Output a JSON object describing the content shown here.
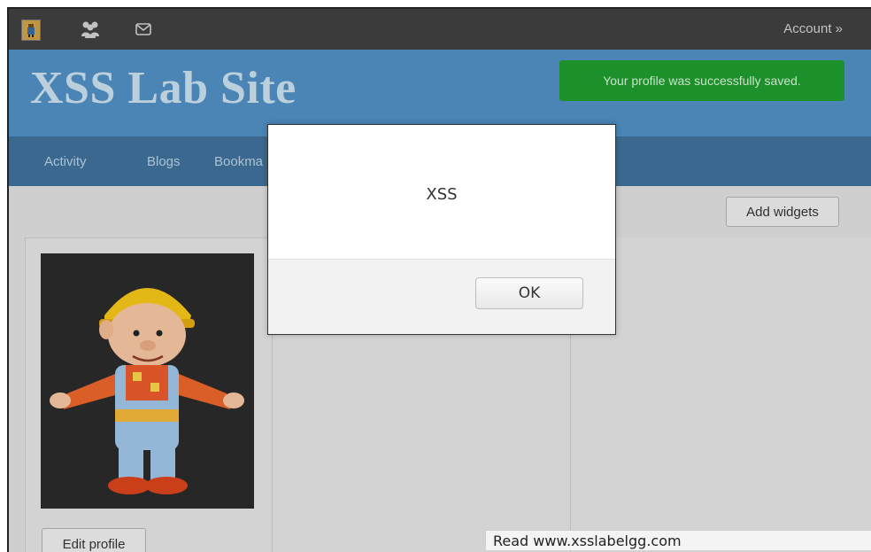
{
  "topbar": {
    "icons": [
      "elgg-logo-icon",
      "friends-icon",
      "mail-icon"
    ],
    "account_label": "Account »"
  },
  "header": {
    "site_title": "XSS Lab Site",
    "flash_message": "Your profile was successfully saved."
  },
  "nav": {
    "items": [
      "Activity",
      "Blogs",
      "Bookma"
    ]
  },
  "content": {
    "add_widgets_label": "Add widgets",
    "edit_profile_label": "Edit profile"
  },
  "dialog": {
    "message": "XSS",
    "ok_label": "OK"
  },
  "status_bar": {
    "text": "Read www.xsslabelgg.com"
  },
  "colors": {
    "topbar": "#3f3f3f",
    "header": "#4f8ec2",
    "nav": "#3f6f97",
    "flash": "#1e9a2e"
  }
}
